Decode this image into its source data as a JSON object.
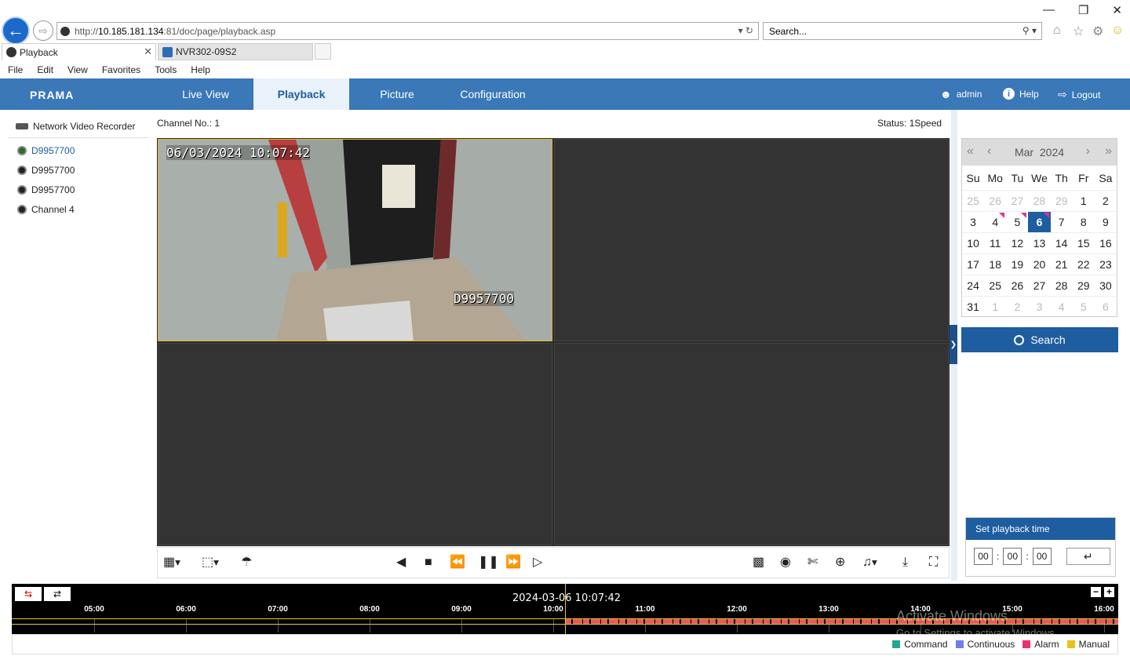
{
  "browser": {
    "url_prefix": "http://",
    "url_host": "10.185.181.134",
    "url_rest": ":81/doc/page/playback.asp",
    "search_placeholder": "Search...",
    "tabs": [
      {
        "label": "Playback"
      },
      {
        "label": "NVR302-09S2"
      }
    ],
    "menu": [
      "File",
      "Edit",
      "View",
      "Favorites",
      "Tools",
      "Help"
    ]
  },
  "app": {
    "logo": "PRAMA",
    "nav": [
      {
        "label": "Live View"
      },
      {
        "label": "Playback",
        "active": true
      },
      {
        "label": "Picture"
      },
      {
        "label": "Configuration"
      }
    ],
    "user": "admin",
    "help": "Help",
    "logout": "Logout"
  },
  "tree": {
    "title": "Network Video Recorder",
    "channels": [
      {
        "label": "D9957700",
        "selected": true
      },
      {
        "label": "D9957700"
      },
      {
        "label": "D9957700"
      },
      {
        "label": "Channel 4"
      }
    ]
  },
  "video": {
    "channel_no": "Channel No.: 1",
    "status": "Status: 1Speed",
    "osd_timestamp": "06/03/2024 10:07:42",
    "osd_name": "D9957700"
  },
  "calendar": {
    "month": "Mar",
    "year": "2024",
    "weekdays": [
      "Su",
      "Mo",
      "Tu",
      "We",
      "Th",
      "Fr",
      "Sa"
    ],
    "days": [
      [
        "25",
        "26",
        "27",
        "28",
        "29",
        "1",
        "2"
      ],
      [
        "3",
        "4",
        "5",
        "6",
        "7",
        "8",
        "9"
      ],
      [
        "10",
        "11",
        "12",
        "13",
        "14",
        "15",
        "16"
      ],
      [
        "17",
        "18",
        "19",
        "20",
        "21",
        "22",
        "23"
      ],
      [
        "24",
        "25",
        "26",
        "27",
        "28",
        "29",
        "30"
      ],
      [
        "31",
        "1",
        "2",
        "3",
        "4",
        "5",
        "6"
      ]
    ],
    "selected_day": "6",
    "recorded_days": [
      "4",
      "5",
      "6"
    ]
  },
  "search_button": "Search",
  "playback_time": {
    "title": "Set playback time",
    "hh": "00",
    "mm": "00",
    "ss": "00"
  },
  "timeline": {
    "current": "2024-03-06 10:07:42",
    "hours": [
      "05:00",
      "06:00",
      "07:00",
      "08:00",
      "09:00",
      "10:00",
      "11:00",
      "12:00",
      "13:00",
      "14:00",
      "15:00",
      "16:00"
    ]
  },
  "legend": [
    {
      "label": "Command",
      "color": "#22a88f"
    },
    {
      "label": "Continuous",
      "color": "#6f7ee8"
    },
    {
      "label": "Alarm",
      "color": "#e8336d"
    },
    {
      "label": "Manual",
      "color": "#e8c21a"
    }
  ],
  "watermark": {
    "line1": "Activate Windows",
    "line2": "Go to Settings to activate Windows."
  }
}
